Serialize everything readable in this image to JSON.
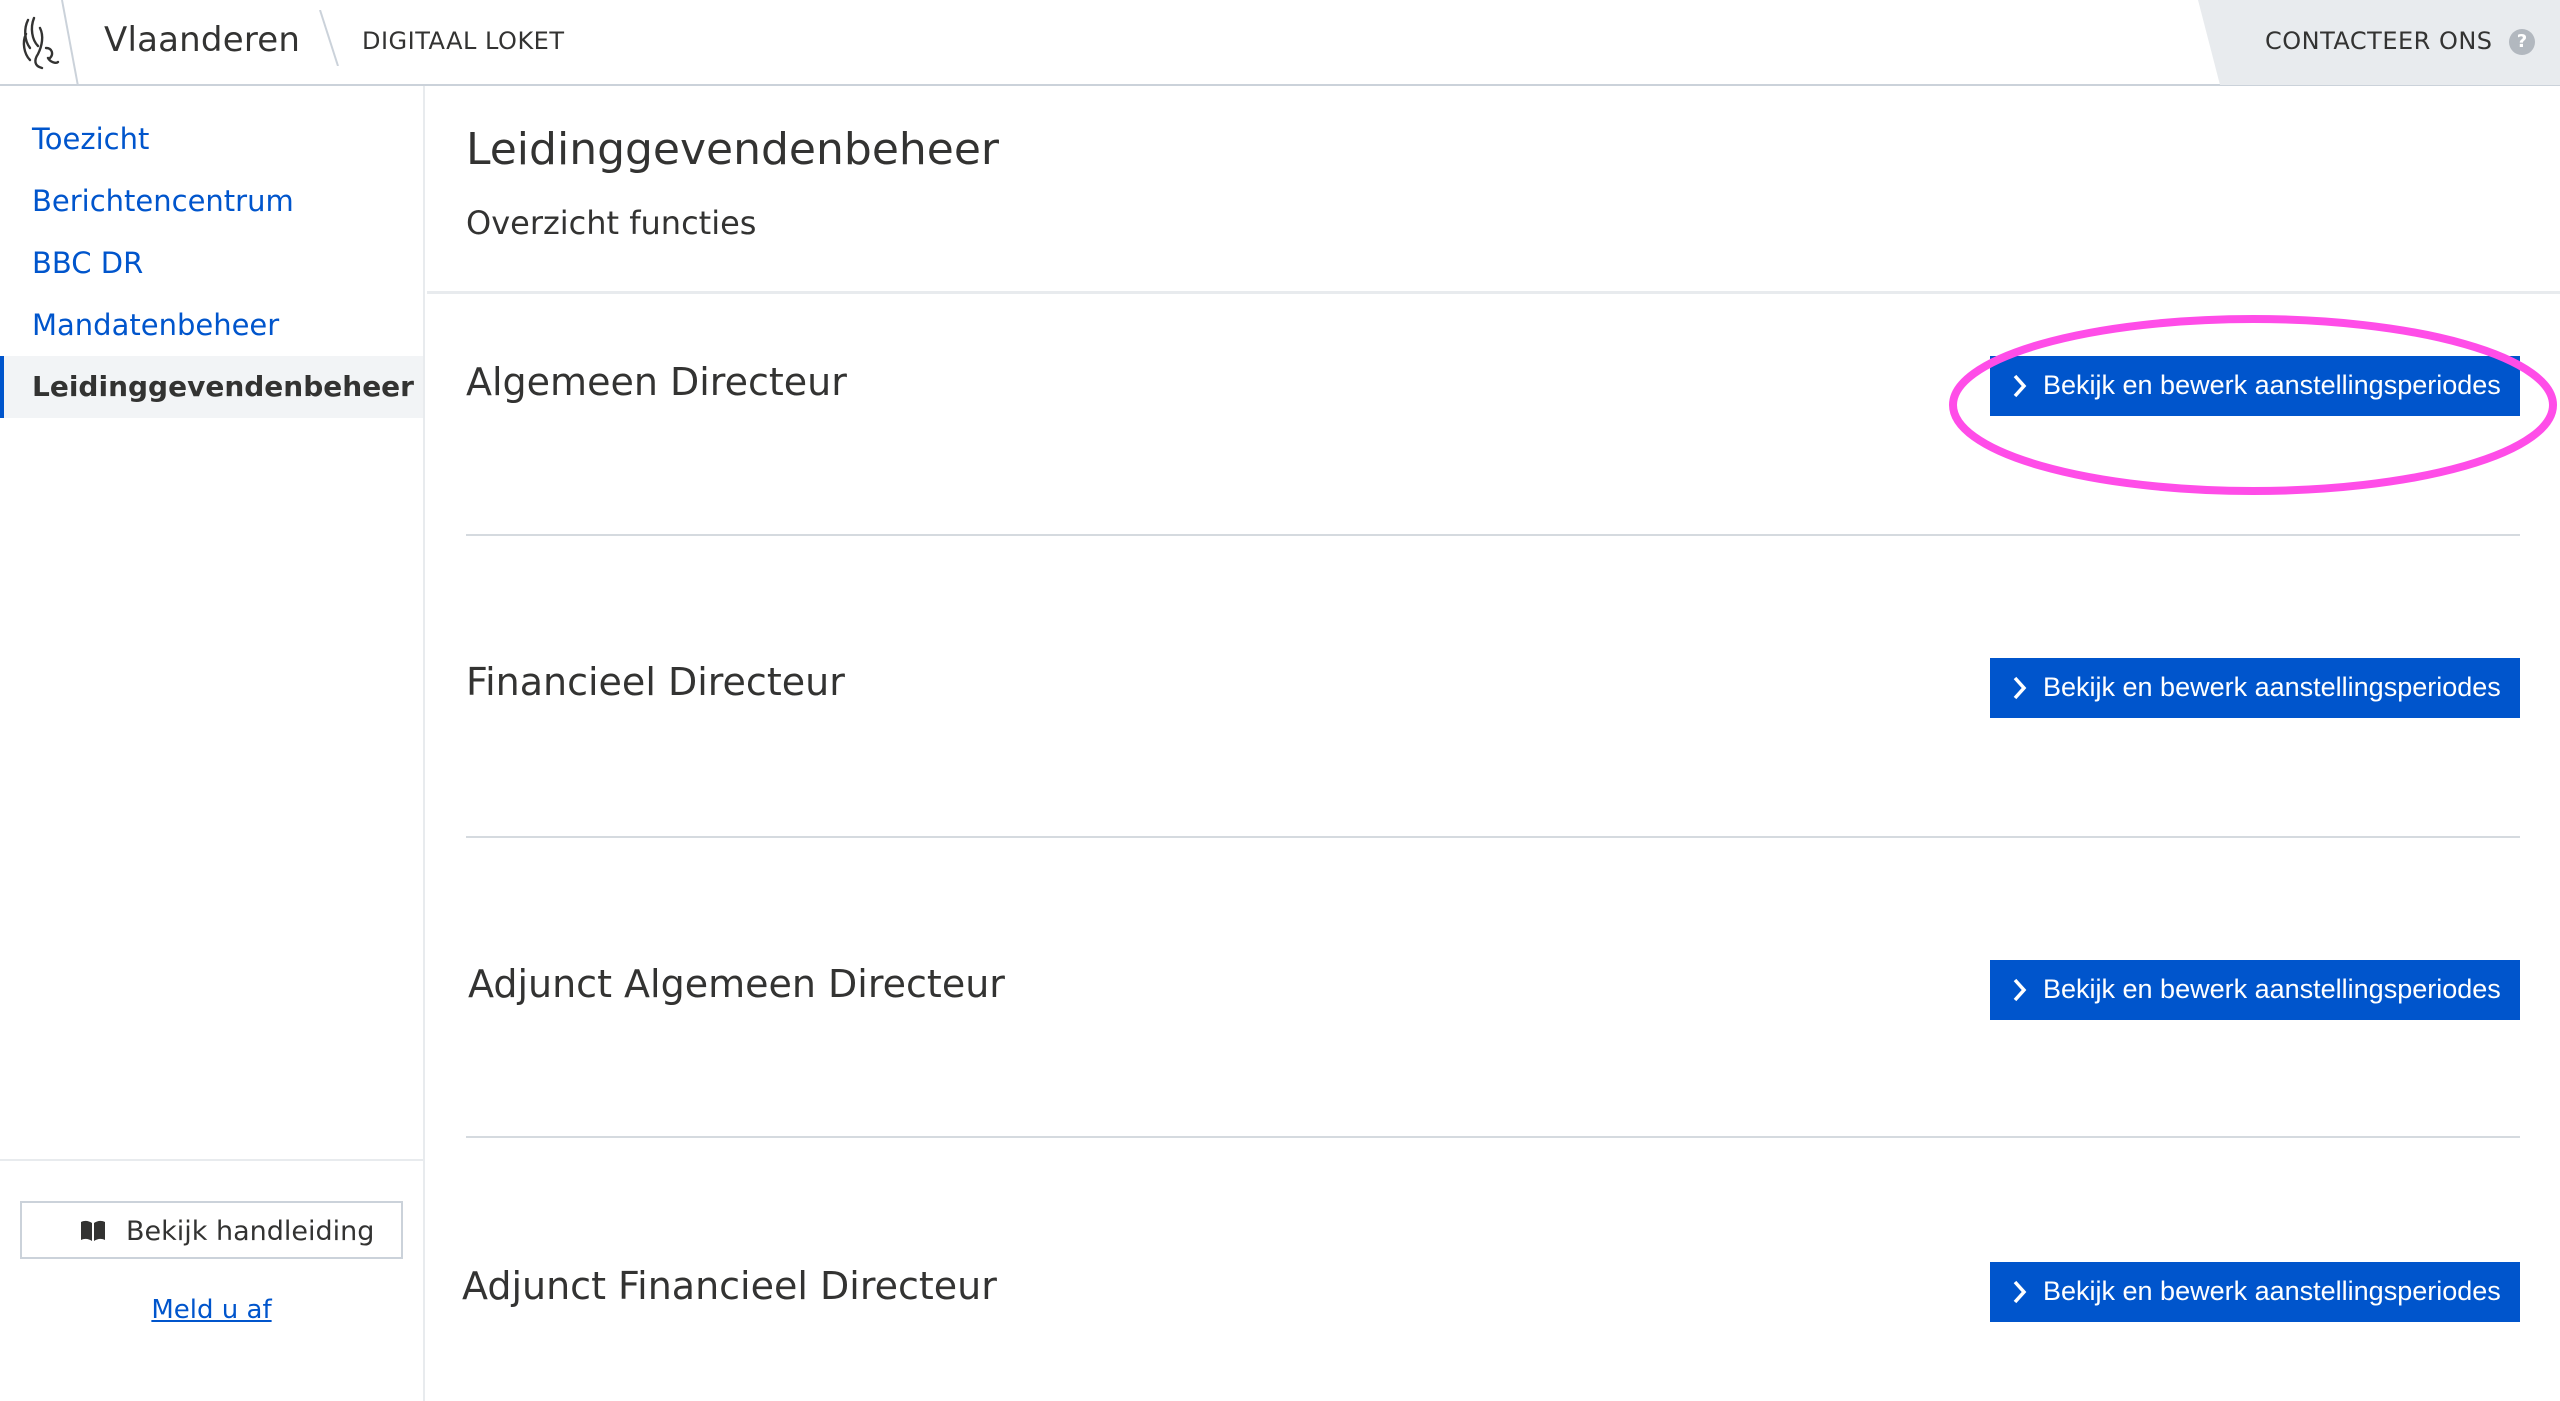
{
  "header": {
    "brand": "Vlaanderen",
    "app_name": "DIGITAAL LOKET",
    "contact_label": "CONTACTEER ONS",
    "help_symbol": "?"
  },
  "sidebar": {
    "items": [
      {
        "label": "Toezicht",
        "active": false
      },
      {
        "label": "Berichtencentrum",
        "active": false
      },
      {
        "label": "BBC DR",
        "active": false
      },
      {
        "label": "Mandatenbeheer",
        "active": false
      },
      {
        "label": "Leidinggevendenbeheer",
        "active": true
      }
    ],
    "manual_button": "Bekijk handleiding",
    "logout_link": "Meld u af"
  },
  "main": {
    "title": "Leidinggevendenbeheer",
    "subtitle": "Overzicht functies",
    "functions": [
      {
        "title": "Algemeen Directeur",
        "button": "Bekijk en bewerk aanstellingsperiodes"
      },
      {
        "title": "Financieel Directeur",
        "button": "Bekijk en bewerk aanstellingsperiodes"
      },
      {
        "title": "Adjunct Algemeen Directeur",
        "button": "Bekijk en bewerk aanstellingsperiodes"
      },
      {
        "title": "Adjunct Financieel Directeur",
        "button": "Bekijk en bewerk aanstellingsperiodes"
      }
    ]
  },
  "colors": {
    "primary": "#0055cc",
    "text": "#333332",
    "highlight": "#ff4de8",
    "divider": "#d5dadf"
  },
  "icons": [
    "flemish-lion-logo-icon",
    "help-icon",
    "book-icon",
    "chevron-right-icon"
  ]
}
